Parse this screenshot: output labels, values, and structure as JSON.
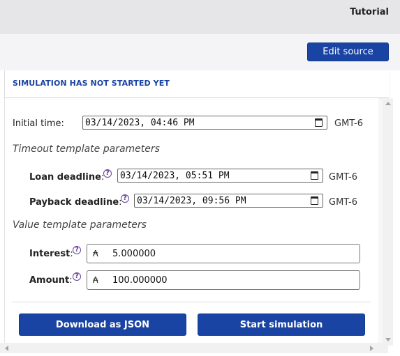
{
  "header": {
    "title": "Tutorial"
  },
  "toolbar": {
    "edit_source_label": "Edit source"
  },
  "status": {
    "text": "SIMULATION HAS NOT STARTED YET"
  },
  "initial_time": {
    "label": "Initial time:",
    "value": "03/14/2023, 04:46 PM",
    "timezone": "GMT-6"
  },
  "timeout_section": {
    "heading": "Timeout template parameters",
    "loan_deadline": {
      "label": "Loan deadline",
      "colon": ":",
      "value": "03/14/2023, 05:51 PM",
      "timezone": "GMT-6"
    },
    "payback_deadline": {
      "label": "Payback deadline",
      "colon": ":",
      "value": "03/14/2023, 09:56 PM",
      "timezone": "GMT-6"
    }
  },
  "value_section": {
    "heading": "Value template parameters",
    "interest": {
      "label": "Interest",
      "colon": ":",
      "prefix": "₳",
      "value": "5.000000"
    },
    "amount": {
      "label": "Amount",
      "colon": ":",
      "prefix": "₳",
      "value": "100.000000"
    }
  },
  "info_glyph": "?",
  "actions": {
    "download_label": "Download as JSON",
    "start_label": "Start simulation"
  },
  "icons": {
    "calendar": "calendar-icon",
    "info": "info-icon",
    "scroll": "scroll-arrow-icon"
  },
  "colors": {
    "primary": "#1a44a3",
    "status_text": "#1a44a3",
    "info": "#6b3fa0"
  }
}
